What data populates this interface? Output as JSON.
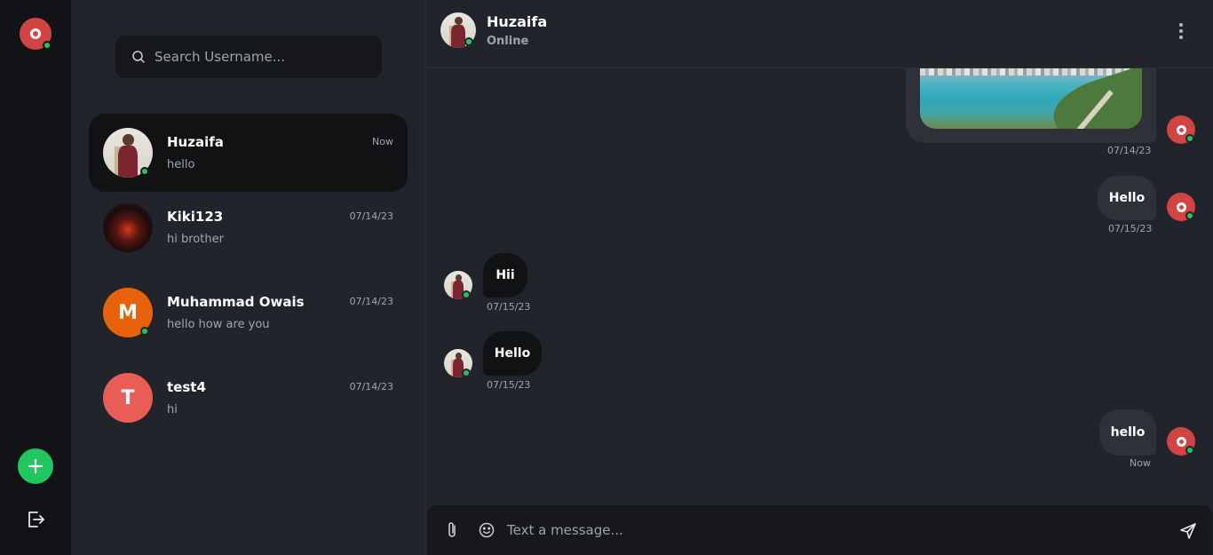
{
  "current_user": {
    "initial": "O",
    "avatar_color": "#d24343",
    "online_color": "#22c55e"
  },
  "search": {
    "placeholder": "Search Username..."
  },
  "conversations": [
    {
      "name": "Huzaifa",
      "preview": "hello",
      "time": "Now",
      "avatar": "photo",
      "online": true,
      "active": true
    },
    {
      "name": "Kiki123",
      "preview": "hi brother",
      "time": "07/14/23",
      "avatar": "photo-dark",
      "online": false,
      "active": false
    },
    {
      "name": "Muhammad Owais",
      "preview": "hello how are you",
      "time": "07/14/23",
      "initial": "M",
      "avatar_color": "#e8620c",
      "online": true,
      "active": false
    },
    {
      "name": "test4",
      "preview": "hi",
      "time": "07/14/23",
      "initial": "T",
      "avatar_color": "#e85d55",
      "online": false,
      "active": false
    }
  ],
  "chat": {
    "header": {
      "name": "Huzaifa",
      "status": "Online"
    },
    "messages": [
      {
        "direction": "out",
        "type": "image",
        "time": "07/14/23"
      },
      {
        "direction": "out",
        "text": "Hello",
        "time": "07/15/23"
      },
      {
        "direction": "in",
        "text": "Hii",
        "time": "07/15/23"
      },
      {
        "direction": "in",
        "text": "Hello",
        "time": "07/15/23"
      },
      {
        "direction": "out",
        "text": "hello",
        "time": "Now"
      }
    ],
    "composer": {
      "placeholder": "Text a message..."
    }
  },
  "icons": {
    "add": "plus-icon",
    "logout": "logout-icon",
    "search": "search-icon",
    "menu": "kebab-menu-icon",
    "attach": "paperclip-icon",
    "emoji": "smiley-icon",
    "send": "send-icon"
  },
  "colors": {
    "accent": "#22c55e",
    "background": "#22242c",
    "rail": "#121316",
    "bubble_out": "#2f3139",
    "bubble_in": "#111214"
  }
}
